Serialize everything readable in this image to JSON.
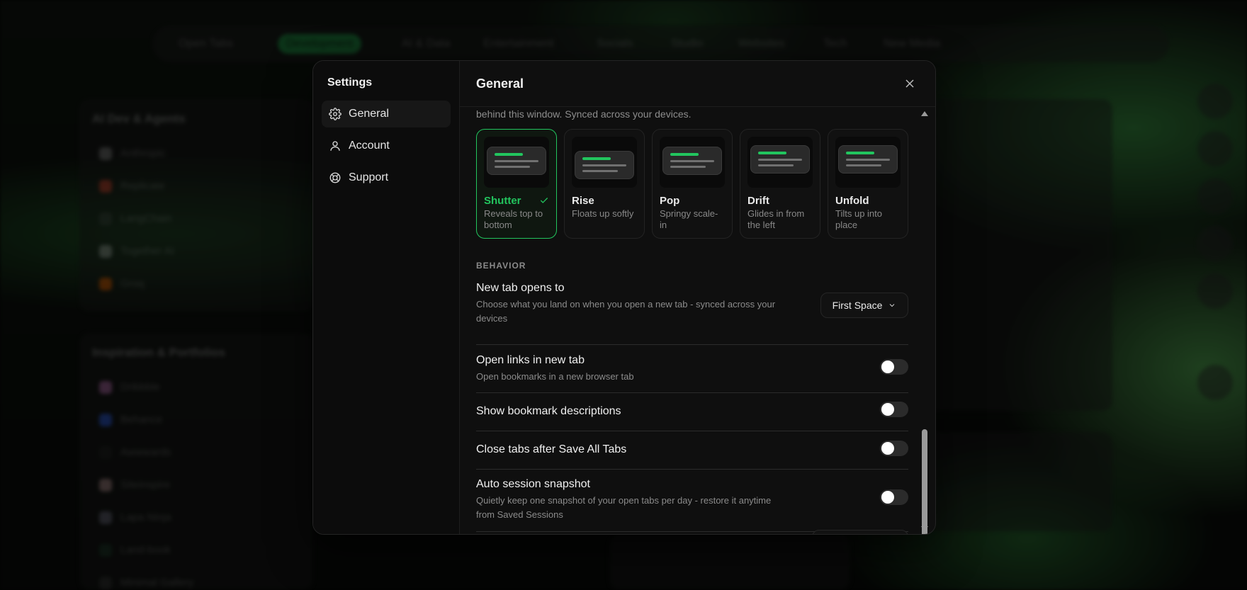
{
  "background": {
    "search_placeholder": "Open Tabs",
    "tabs": [
      "Development",
      "AI & Data",
      "Entertainment",
      "Socials",
      "Studio",
      "Websites",
      "Tech",
      "New Media"
    ],
    "cards": [
      {
        "title": "AI Dev & Agents",
        "items": [
          "Anthropic",
          "Replicate",
          "LangChain",
          "Together AI",
          "Groq"
        ]
      },
      {
        "title": "Inspiration & Portfolios",
        "items": [
          "Dribbble",
          "Behance",
          "Awwwards",
          "Siteinspire",
          "Lapa Ninja",
          "Land-book",
          "Minimal Gallery"
        ]
      }
    ]
  },
  "sidebar": {
    "title": "Settings",
    "items": [
      {
        "label": "General",
        "icon": "gear-icon"
      },
      {
        "label": "Account",
        "icon": "user-icon"
      },
      {
        "label": "Support",
        "icon": "lifebuoy-icon"
      }
    ]
  },
  "main": {
    "title": "General",
    "intro": "behind this window. Synced across your devices.",
    "animations": [
      {
        "name": "Shutter",
        "desc": "Reveals top to bottom",
        "selected": true
      },
      {
        "name": "Rise",
        "desc": "Floats up softly",
        "selected": false
      },
      {
        "name": "Pop",
        "desc": "Springy scale-in",
        "selected": false
      },
      {
        "name": "Drift",
        "desc": "Glides in from the left",
        "selected": false
      },
      {
        "name": "Unfold",
        "desc": "Tilts up into place",
        "selected": false
      }
    ],
    "behavior_label": "BEHAVIOR",
    "settings": {
      "new_tab": {
        "title": "New tab opens to",
        "desc": "Choose what you land on when you open a new tab - synced across your devices",
        "value": "First Space"
      },
      "open_links": {
        "title": "Open links in new tab",
        "desc": "Open bookmarks in a new browser tab",
        "on": false
      },
      "show_desc": {
        "title": "Show bookmark descriptions",
        "on": false
      },
      "close_tabs": {
        "title": "Close tabs after Save All Tabs",
        "on": false
      },
      "auto_snapshot": {
        "title": "Auto session snapshot",
        "desc": "Quietly keep one snapshot of your open tabs per day - restore it anytime from Saved Sessions",
        "on": false
      }
    }
  },
  "colors": {
    "accent": "#22c55e",
    "surface": "#0f0f0f",
    "border": "#242424"
  }
}
